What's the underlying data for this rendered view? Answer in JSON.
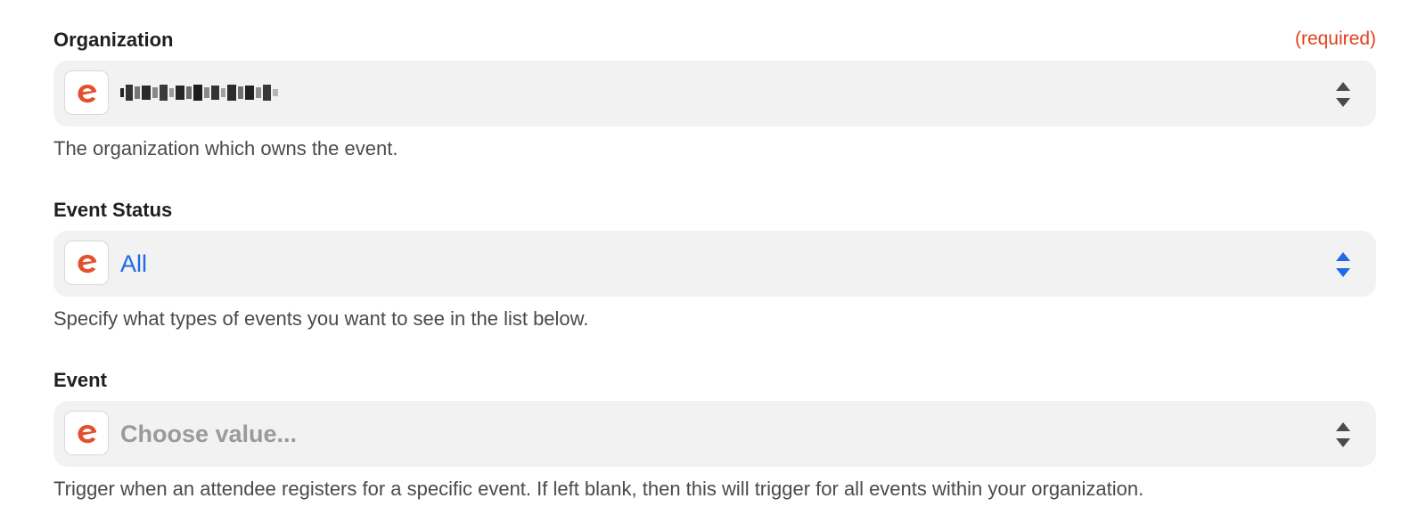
{
  "fields": [
    {
      "label": "Organization",
      "required_label": "(required)",
      "value": "",
      "help": "The organization which owns the event."
    },
    {
      "label": "Event Status",
      "value": "All",
      "help": "Specify what types of events you want to see in the list below."
    },
    {
      "label": "Event",
      "placeholder": "Choose value...",
      "help": "Trigger when an attendee registers for a specific event. If left blank, then this will trigger for all events within your organization."
    }
  ],
  "colors": {
    "required": "#e0421b",
    "accent": "#1f6ae8",
    "app_icon": "#e2512f",
    "chevron_default": "#4a4a4a"
  },
  "icons": {
    "app": "eventbrite-e-icon",
    "dropdown": "up-down-chevron-icon"
  }
}
